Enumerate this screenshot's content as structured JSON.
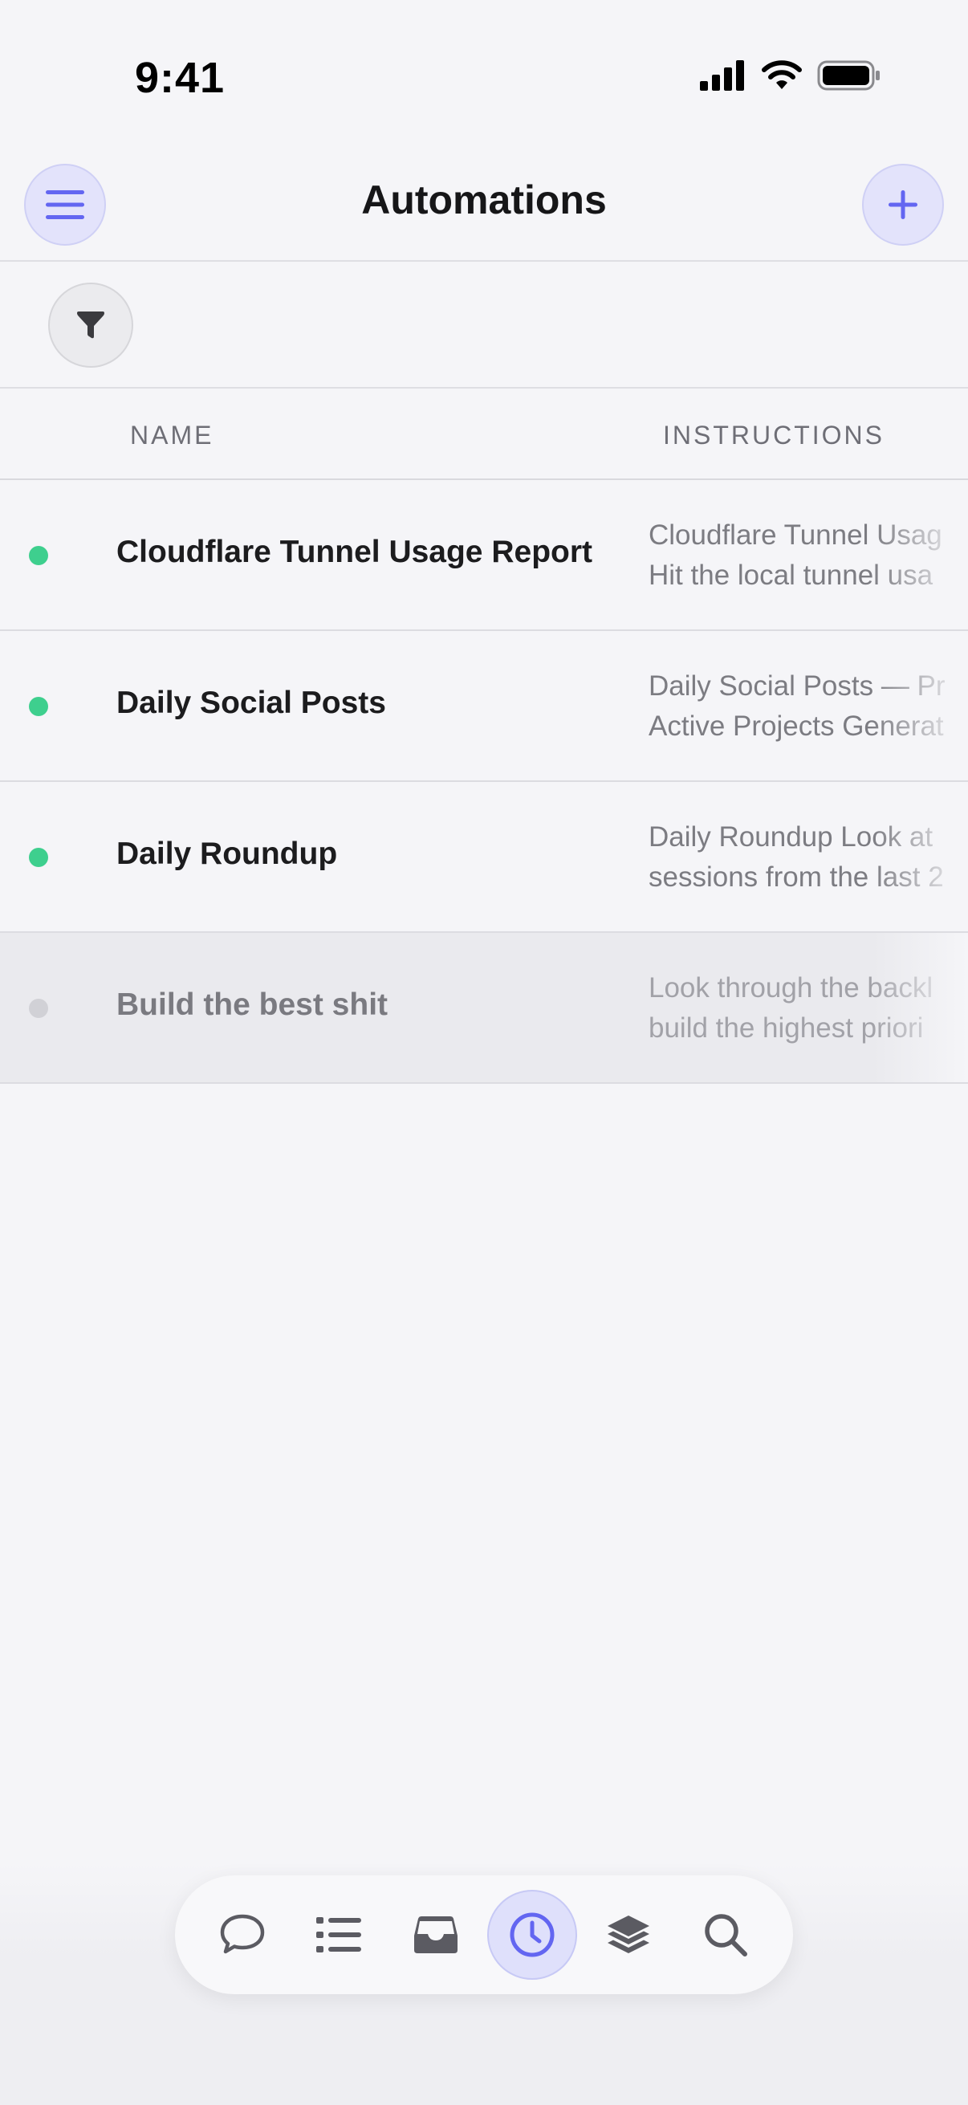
{
  "status_bar": {
    "time": "9:41"
  },
  "header": {
    "title": "Automations"
  },
  "table": {
    "columns": {
      "name": "NAME",
      "instructions": "INSTRUCTIONS"
    },
    "rows": [
      {
        "name": "Cloudflare Tunnel Usage Report",
        "instructions_line1": "Cloudflare Tunnel Usag",
        "instructions_line2": "Hit the local tunnel usa",
        "status": "active",
        "status_color": "#3ecf8e"
      },
      {
        "name": "Daily Social Posts",
        "instructions_line1": "Daily Social Posts — Pr",
        "instructions_line2": "Active Projects Generat",
        "status": "active",
        "status_color": "#3ecf8e"
      },
      {
        "name": "Daily Roundup",
        "instructions_line1": "Daily Roundup Look at",
        "instructions_line2": "sessions from the last 2",
        "status": "active",
        "status_color": "#3ecf8e"
      },
      {
        "name": "Build the best shit",
        "instructions_line1": "Look through the backl",
        "instructions_line2": "build the highest priori",
        "status": "inactive",
        "status_color": "#d1d1d6"
      }
    ]
  },
  "tab_bar": {
    "tabs": [
      {
        "icon": "chat-bubble-icon",
        "active": false
      },
      {
        "icon": "list-icon",
        "active": false
      },
      {
        "icon": "inbox-icon",
        "active": false
      },
      {
        "icon": "clock-icon",
        "active": true
      },
      {
        "icon": "layers-icon",
        "active": false
      },
      {
        "icon": "search-icon",
        "active": false
      }
    ]
  },
  "colors": {
    "accent": "#6366f1",
    "accent_bg": "#e3e3fb",
    "active_dot": "#3ecf8e",
    "inactive_dot": "#d1d1d6"
  }
}
